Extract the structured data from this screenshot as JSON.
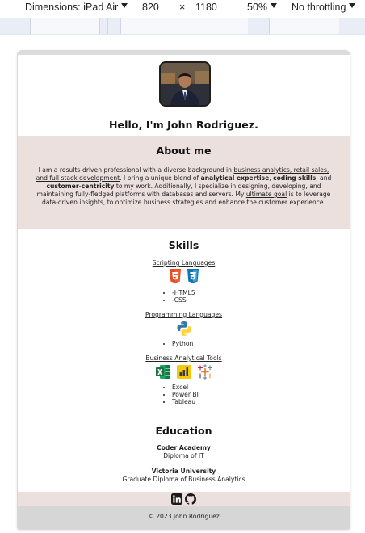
{
  "toolbar": {
    "dimensions_label": "Dimensions: iPad Air",
    "width": "820",
    "times": "×",
    "height": "1180",
    "zoom": "50%",
    "throttling": "No throttling"
  },
  "hero": {
    "greeting": "Hello, I'm John Rodriguez."
  },
  "about": {
    "title": "About me",
    "parts": [
      "I am a results-driven professional with a diverse background in ",
      "business analytics, retail sales, and full stack development",
      ". I bring a unique blend of ",
      "analytical expertise",
      ", ",
      "coding skills",
      ", and ",
      "customer-centricity",
      " to my work. Additionally, I specialize in designing, developing, and maintaining fully-fledged platforms with databases and servers. My ",
      "ultimate goal",
      " is to leverage data-driven insights, to optimize business strategies and enhance the customer experience."
    ]
  },
  "skills": {
    "title": "Skills",
    "groups": [
      {
        "heading": "Scripting Languages",
        "icons": [
          "html5-icon",
          "css3-icon"
        ],
        "items": [
          "-HTML5",
          "-CSS"
        ]
      },
      {
        "heading": "Programming Languages",
        "icons": [
          "python-icon"
        ],
        "items": [
          "Python"
        ]
      },
      {
        "heading": "Business Analytical Tools",
        "icons": [
          "excel-icon",
          "power-bi-icon",
          "tableau-icon"
        ],
        "items": [
          "Excel",
          "Power BI",
          "Tableau"
        ]
      }
    ]
  },
  "education": {
    "title": "Education",
    "entries": [
      {
        "school": "Coder Academy",
        "degree": "Diploma of IT"
      },
      {
        "school": "Victoria University",
        "degree": "Graduate Diploma of Business Analytics"
      }
    ]
  },
  "social": {
    "icons": [
      "linkedin-icon",
      "github-icon"
    ]
  },
  "footer": {
    "copyright": "© 2023 John Rodriguez"
  },
  "colors": {
    "section_bg": "#ece0de",
    "footer_bg": "#d6d6d6",
    "html5": "#e44d26",
    "css3": "#1572b6",
    "excel": "#1f7244",
    "powerbi": "#f2c811"
  }
}
